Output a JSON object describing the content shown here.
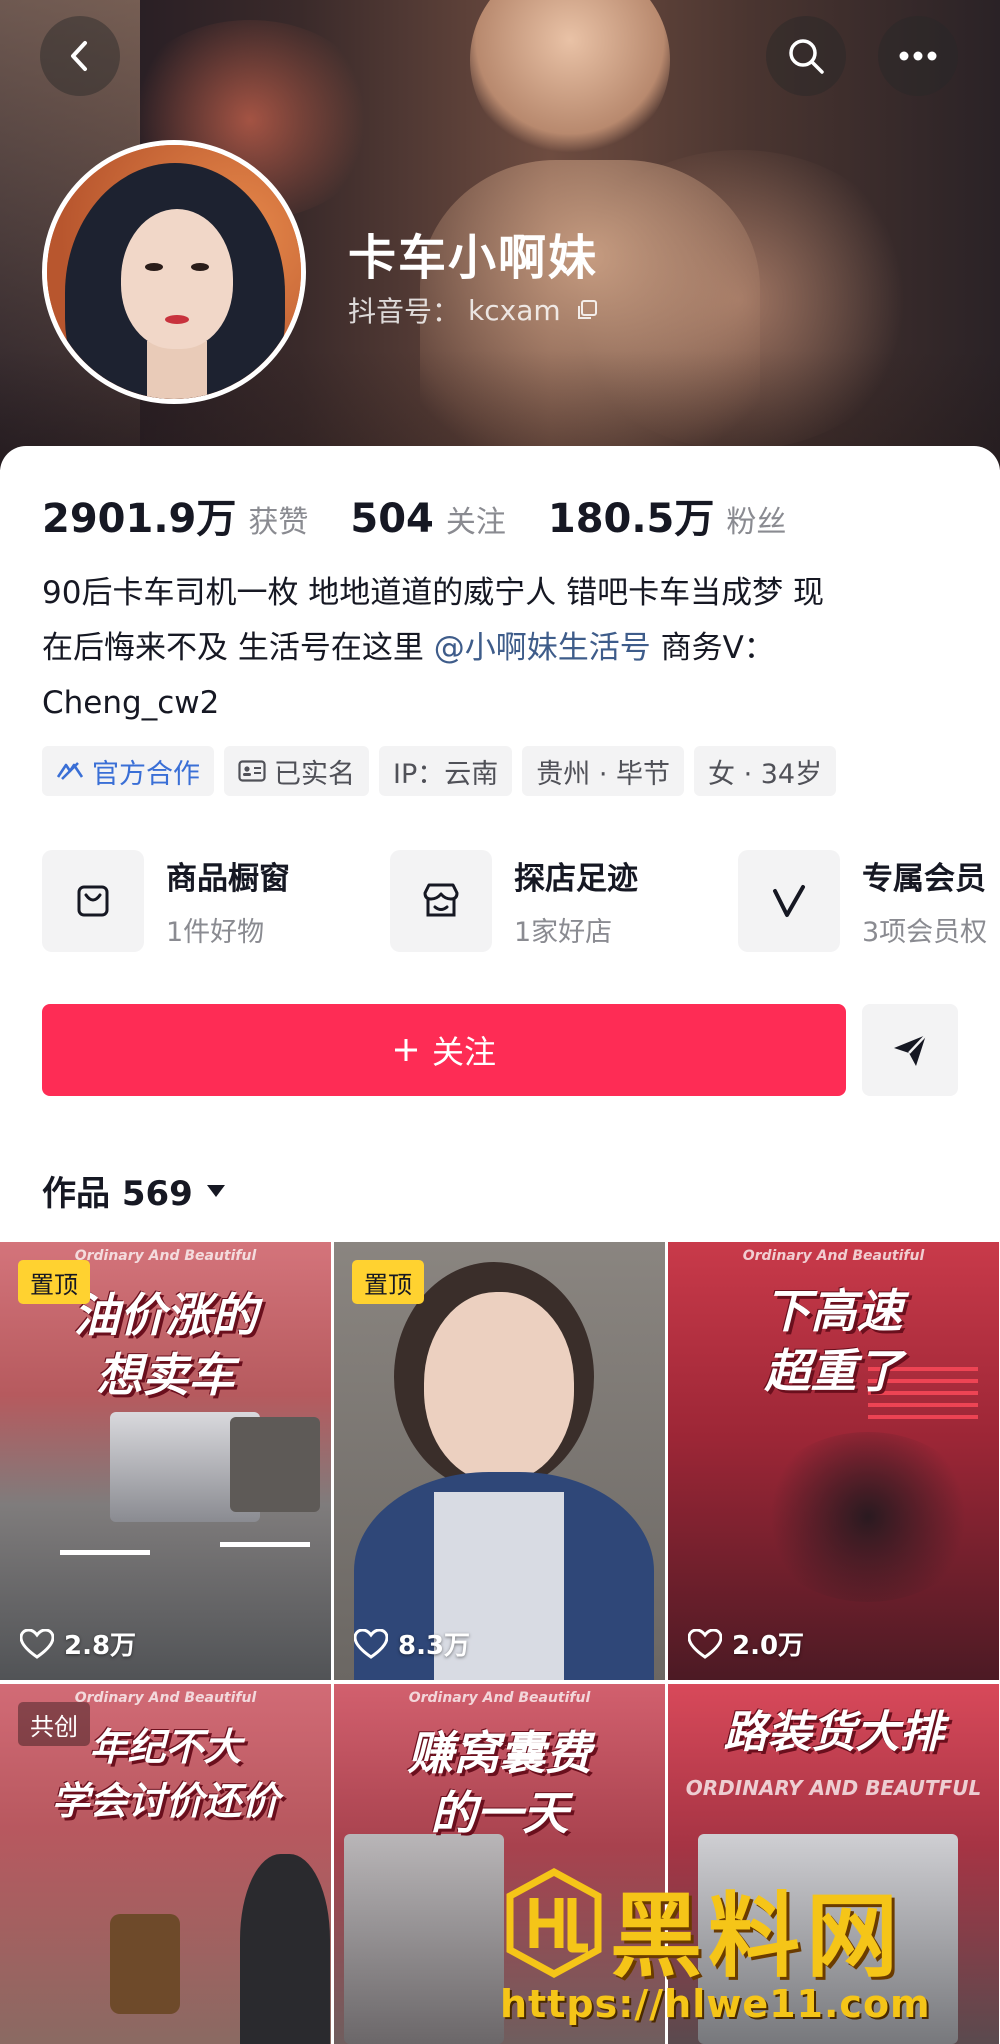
{
  "profile": {
    "name": "卡车小啊妹",
    "douyin_id_label": "抖音号：",
    "douyin_id": "kcxam"
  },
  "stats": [
    {
      "value": "2901.9万",
      "label": "获赞"
    },
    {
      "value": "504",
      "label": "关注"
    },
    {
      "value": "180.5万",
      "label": "粉丝"
    }
  ],
  "bio": {
    "line1": "90后卡车司机一枚  地地道道的威宁人  错吧卡车当成梦 现",
    "line2_pre": "在后悔来不及  生活号在这里 ",
    "line2_link": "@小啊妹生活号",
    "line2_post": " 商务V：",
    "line3": "Cheng_cw2"
  },
  "tags": [
    {
      "label": "官方合作",
      "icon": "handshake-icon"
    },
    {
      "label": "已实名",
      "icon": "id-card-icon"
    },
    {
      "label": "IP：云南"
    },
    {
      "label": "贵州 · 毕节"
    },
    {
      "label": "女 · 34岁"
    }
  ],
  "services": [
    {
      "title": "商品橱窗",
      "sub": "1件好物",
      "icon": "shopping-bag-icon"
    },
    {
      "title": "探店足迹",
      "sub": "1家好店",
      "icon": "store-icon"
    },
    {
      "title": "专属会员",
      "sub": "3项会员权",
      "icon": "vip-v-icon"
    }
  ],
  "actions": {
    "follow_label": "关注",
    "share_icon": "send-icon"
  },
  "works": {
    "label": "作品 569"
  },
  "tiles": [
    {
      "eyebrow": "Ordinary And Beautiful",
      "caption1": "油价涨的",
      "caption2": "想卖车",
      "badge": "置顶",
      "likes": "2.8万"
    },
    {
      "eyebrow": "",
      "caption1": "",
      "caption2": "",
      "badge": "置顶",
      "likes": "8.3万"
    },
    {
      "eyebrow": "Ordinary And Beautiful",
      "caption1": "下高速",
      "caption2": "超重了",
      "badge": "",
      "likes": "2.0万"
    },
    {
      "eyebrow": "Ordinary And Beautiful",
      "caption1": "年纪不大",
      "caption2": "学会讨价还价",
      "badge": "共创",
      "likes": ""
    },
    {
      "eyebrow": "Ordinary And Beautiful",
      "caption1": "赚窝囊费",
      "caption2": "的一天",
      "badge": "",
      "likes": ""
    },
    {
      "eyebrow": "ORDINARY AND BEAUTFUL",
      "caption1": "路装货大排",
      "caption2": "",
      "badge": "",
      "likes": ""
    }
  ],
  "watermark": {
    "brand": "黑料网",
    "url": "https://hlwe11.com"
  },
  "colors": {
    "accent": "#fe2c55",
    "link": "#3e5c8a",
    "pin_badge": "#ffd230",
    "official": "#3a6fd6"
  }
}
